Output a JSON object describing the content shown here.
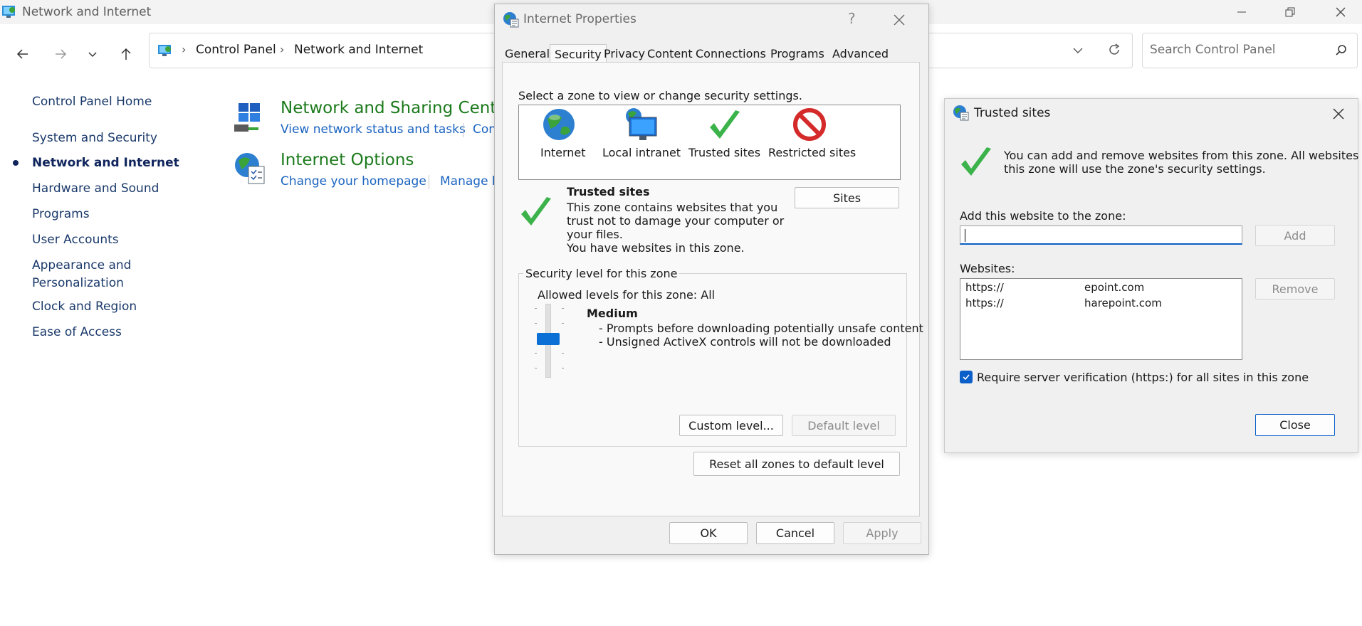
{
  "window": {
    "title": "Network and Internet",
    "minimize_icon": "minimize-icon",
    "maximize_icon": "restore-icon",
    "close_icon": "close-icon"
  },
  "address_bar": {
    "crumbs": [
      "Control Panel",
      "Network and Internet"
    ],
    "search_placeholder": "Search Control Panel"
  },
  "left_nav": {
    "items": [
      {
        "label": "Control Panel Home"
      },
      {
        "label": "System and Security"
      },
      {
        "label": "Network and Internet",
        "active": true
      },
      {
        "label": "Hardware and Sound"
      },
      {
        "label": "Programs"
      },
      {
        "label": "User Accounts"
      },
      {
        "label": "Appearance and",
        "label2": "Personalization"
      },
      {
        "label": "Clock and Region"
      },
      {
        "label": "Ease of Access"
      }
    ]
  },
  "categories": [
    {
      "title": "Network and Sharing Center",
      "links": [
        "View network status and tasks",
        "Con"
      ]
    },
    {
      "title": "Internet Options",
      "links": [
        "Change your homepage",
        "Manage b"
      ]
    }
  ],
  "internet_properties": {
    "title": "Internet Properties",
    "help": "?",
    "tabs": [
      "General",
      "Security",
      "Privacy",
      "Content",
      "Connections",
      "Programs",
      "Advanced"
    ],
    "selected_tab": "Security",
    "zone_prompt": "Select a zone to view or change security settings.",
    "zones": [
      "Internet",
      "Local intranet",
      "Trusted sites",
      "Restricted sites"
    ],
    "zone_title": "Trusted sites",
    "zone_desc": [
      "This zone contains websites that you",
      "trust not to damage your computer or",
      "your files.",
      "You have websites in this zone."
    ],
    "sites_button": "Sites",
    "group_title": "Security level for this zone",
    "allowed_levels": "Allowed levels for this zone: All",
    "level_name": "Medium",
    "level_bullets": [
      "- Prompts before downloading potentially unsafe content",
      "- Unsigned ActiveX controls will not be downloaded"
    ],
    "custom_level": "Custom level...",
    "default_level": "Default level",
    "reset_all": "Reset all zones to default level",
    "ok": "OK",
    "cancel": "Cancel",
    "apply": "Apply"
  },
  "trusted_sites": {
    "title": "Trusted sites",
    "info": [
      "You can add and remove websites from this zone. All websites in",
      "this zone will use the zone's security settings."
    ],
    "add_label": "Add this website to the zone:",
    "add_value": "",
    "add_button": "Add",
    "websites_label": "Websites:",
    "websites": [
      {
        "prefix": "https://",
        "suffix": "epoint.com"
      },
      {
        "prefix": "https://",
        "suffix": "harepoint.com"
      }
    ],
    "remove_button": "Remove",
    "require_https": "Require server verification (https:) for all sites in this zone",
    "require_https_checked": true,
    "close_button": "Close"
  },
  "colors": {
    "accent": "#0b6fd6",
    "category_title": "#1b7a1b",
    "link": "#1a63c1",
    "nav_text": "#1b3a6b"
  }
}
